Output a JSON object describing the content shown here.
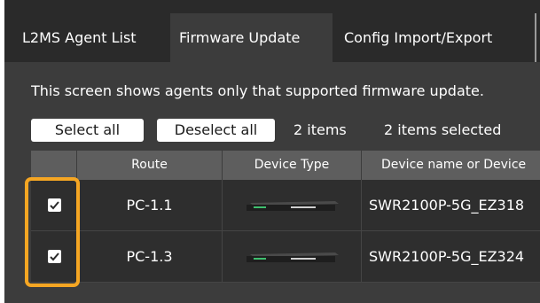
{
  "tabs": [
    {
      "label": "L2MS Agent List",
      "active": false
    },
    {
      "label": "Firmware Update",
      "active": true
    },
    {
      "label": "Config Import/Export",
      "active": false
    }
  ],
  "description": "This screen shows agents only that supported firmware update.",
  "toolbar": {
    "select_all": "Select all",
    "deselect_all": "Deselect all",
    "items_count": "2 items",
    "selected_count": "2 items selected"
  },
  "table": {
    "headers": [
      "",
      "Route",
      "Device Type",
      "Device name or Device"
    ],
    "rows": [
      {
        "checked": true,
        "route": "PC-1.1",
        "device_type_icon": "switch-device-icon",
        "device_name": "SWR2100P-5G_EZ318"
      },
      {
        "checked": true,
        "route": "PC-1.3",
        "device_type_icon": "switch-device-icon",
        "device_name": "SWR2100P-5G_EZ324"
      }
    ]
  },
  "colors": {
    "panel_bg": "#3c3c3c",
    "tabbar_bg": "#2a2a2a",
    "header_bg": "#5e5e5e",
    "row_bg": "#2e2e2e",
    "highlight": "#f5a623"
  }
}
